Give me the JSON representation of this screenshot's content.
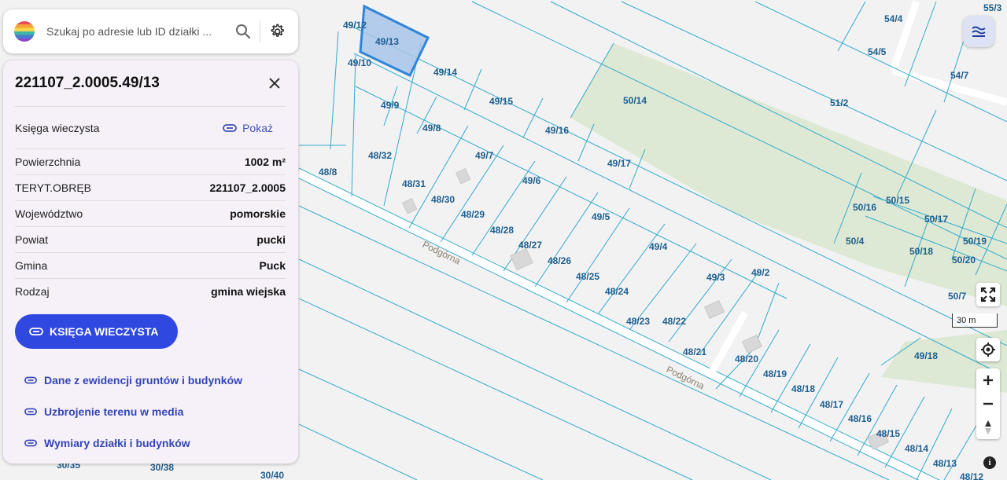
{
  "search": {
    "placeholder": "Szukaj po adresie lub ID działki ..."
  },
  "icons": {
    "logo": "rainbow-logo",
    "search": "search-icon",
    "settings": "gear-icon",
    "close": "close-icon",
    "link": "link-icon",
    "layers": "layers-icon",
    "fullscreen": "fullscreen-icon",
    "locate": "locate-icon",
    "zoom_in": "plus-icon",
    "zoom_out": "minus-icon",
    "compass": "compass-icon",
    "info": "info-icon"
  },
  "panel": {
    "title": "221107_2.0005.49/13",
    "ksiega": {
      "label": "Księga wieczysta",
      "action": "Pokaż"
    },
    "rows": [
      {
        "label": "Powierzchnia",
        "value": "1002 m²"
      },
      {
        "label": "TERYT.OBRĘB",
        "value": "221107_2.0005"
      },
      {
        "label": "Województwo",
        "value": "pomorskie"
      },
      {
        "label": "Powiat",
        "value": "pucki"
      },
      {
        "label": "Gmina",
        "value": "Puck"
      },
      {
        "label": "Rodzaj",
        "value": "gmina wiejska"
      }
    ],
    "button_label": "KSIĘGA WIECZYSTA",
    "links": [
      "Dane z ewidencji gruntów i budynków",
      "Uzbrojenie terenu w media",
      "Wymiary działki i budynków"
    ]
  },
  "map": {
    "street_name": "Podgórna",
    "selected_plot": "49/13",
    "plot_labels": [
      "49/12",
      "49/13",
      "49/10",
      "49/14",
      "49/15",
      "49/9",
      "49/8",
      "49/16",
      "48/32",
      "49/7",
      "49/17",
      "48/8",
      "48/31",
      "49/6",
      "48/30",
      "48/29",
      "48/28",
      "49/5",
      "48/27",
      "49/4",
      "48/26",
      "48/25",
      "49/3",
      "49/2",
      "48/24",
      "48/23",
      "48/22",
      "48/21",
      "48/20",
      "48/19",
      "48/18",
      "48/17",
      "48/16",
      "48/15",
      "48/14",
      "48/13",
      "48/12",
      "49/18",
      "50/14",
      "51/2",
      "54/4",
      "54/5",
      "54/7",
      "55/3",
      "50/16",
      "50/15",
      "50/17",
      "50/4",
      "50/18",
      "50/19",
      "50/20",
      "50/7",
      "30/35",
      "30/38",
      "30/40"
    ],
    "scale": "30 m",
    "colors": {
      "parcel_line": "#33aacc",
      "selected_fill": "#a9c6ea",
      "selected_stroke": "#2f86d8",
      "green_area": "#dde9d4",
      "road": "#ffffff",
      "label": "#1f5f8f"
    }
  }
}
